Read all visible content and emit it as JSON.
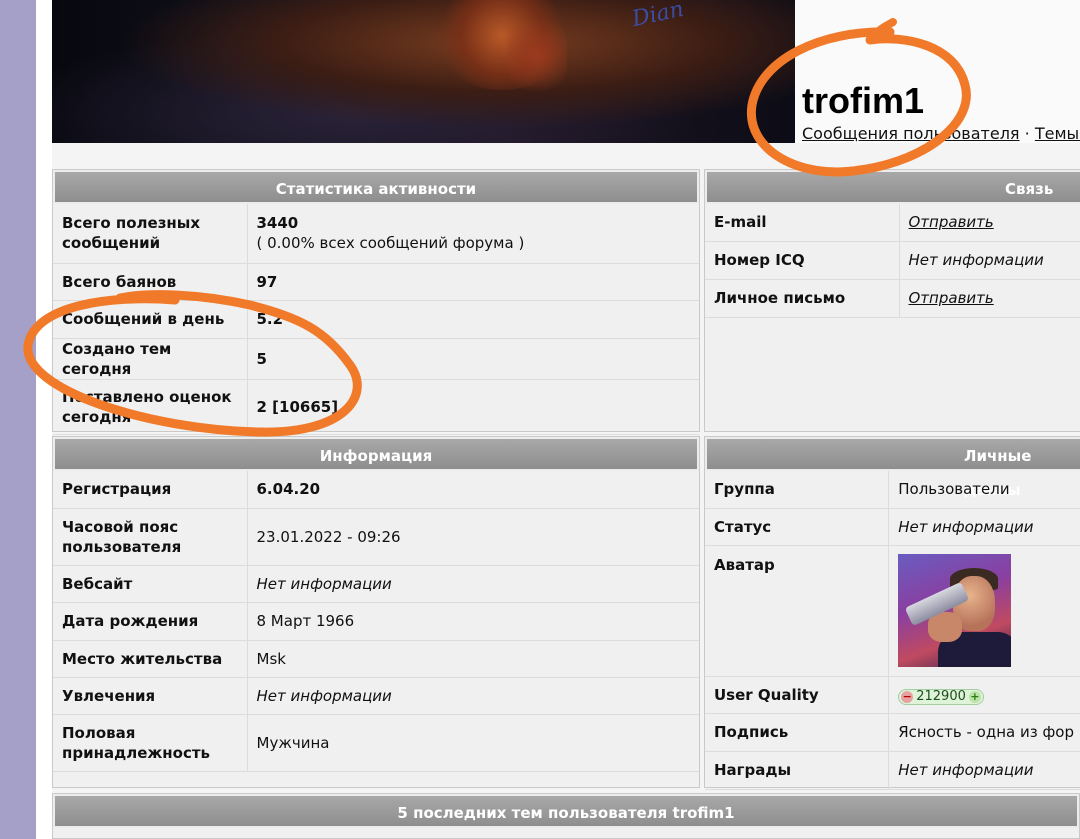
{
  "header": {
    "username": "trofim1",
    "links": [
      "Сообщения пользователя",
      "Темы по"
    ],
    "link_separator": "·"
  },
  "activity": {
    "title": "Статистика активности",
    "rows": [
      {
        "label": "Всего полезных сообщений",
        "value": "3440",
        "sub": "( 0.00% всех сообщений форума )"
      },
      {
        "label": "Всего баянов",
        "value": "97"
      },
      {
        "label": "Сообщений в день",
        "value": "5.2"
      },
      {
        "label": "Создано тем сегодня",
        "value": "5"
      },
      {
        "label": "Поставлено оценок сегодня",
        "value": "2 [10665]"
      }
    ]
  },
  "contact": {
    "title": "Связь",
    "rows": [
      {
        "label": "E-mail",
        "value": "Отправить"
      },
      {
        "label": "Номер ICQ",
        "value": "Нет информации"
      },
      {
        "label": "Личное письмо",
        "value": "Отправить"
      }
    ]
  },
  "info": {
    "title": "Информация",
    "rows": [
      {
        "label": "Регистрация",
        "value": "6.04.20"
      },
      {
        "label": "Часовой пояс пользователя",
        "value": "23.01.2022 - 09:26"
      },
      {
        "label": "Вебсайт",
        "value": "Нет информации"
      },
      {
        "label": "Дата рождения",
        "value": "8 Март 1966"
      },
      {
        "label": "Место жительства",
        "value": "Msk"
      },
      {
        "label": "Увлечения",
        "value": "Нет информации"
      },
      {
        "label": "Половая принадлежность",
        "value": "Мужчина"
      }
    ]
  },
  "personal": {
    "title": "Личные данны",
    "rows": [
      {
        "label": "Группа",
        "value": "Пользователи"
      },
      {
        "label": "Статус",
        "value": "Нет информации"
      },
      {
        "label": "Аватар"
      },
      {
        "label": "User Quality",
        "value": "212900",
        "minus": "−",
        "plus": "+"
      },
      {
        "label": "Подпись",
        "value": "Ясность - одна из фор"
      },
      {
        "label": "Награды",
        "value": "Нет информации"
      }
    ]
  },
  "banner": {
    "signature": "Dian"
  },
  "recent_topics": {
    "title": "5 последних тем пользователя trofim1"
  },
  "colors": {
    "annotation": "#f07a2a",
    "panel_head": "#9a9a9a",
    "left_strip": "#a5a0c8"
  }
}
